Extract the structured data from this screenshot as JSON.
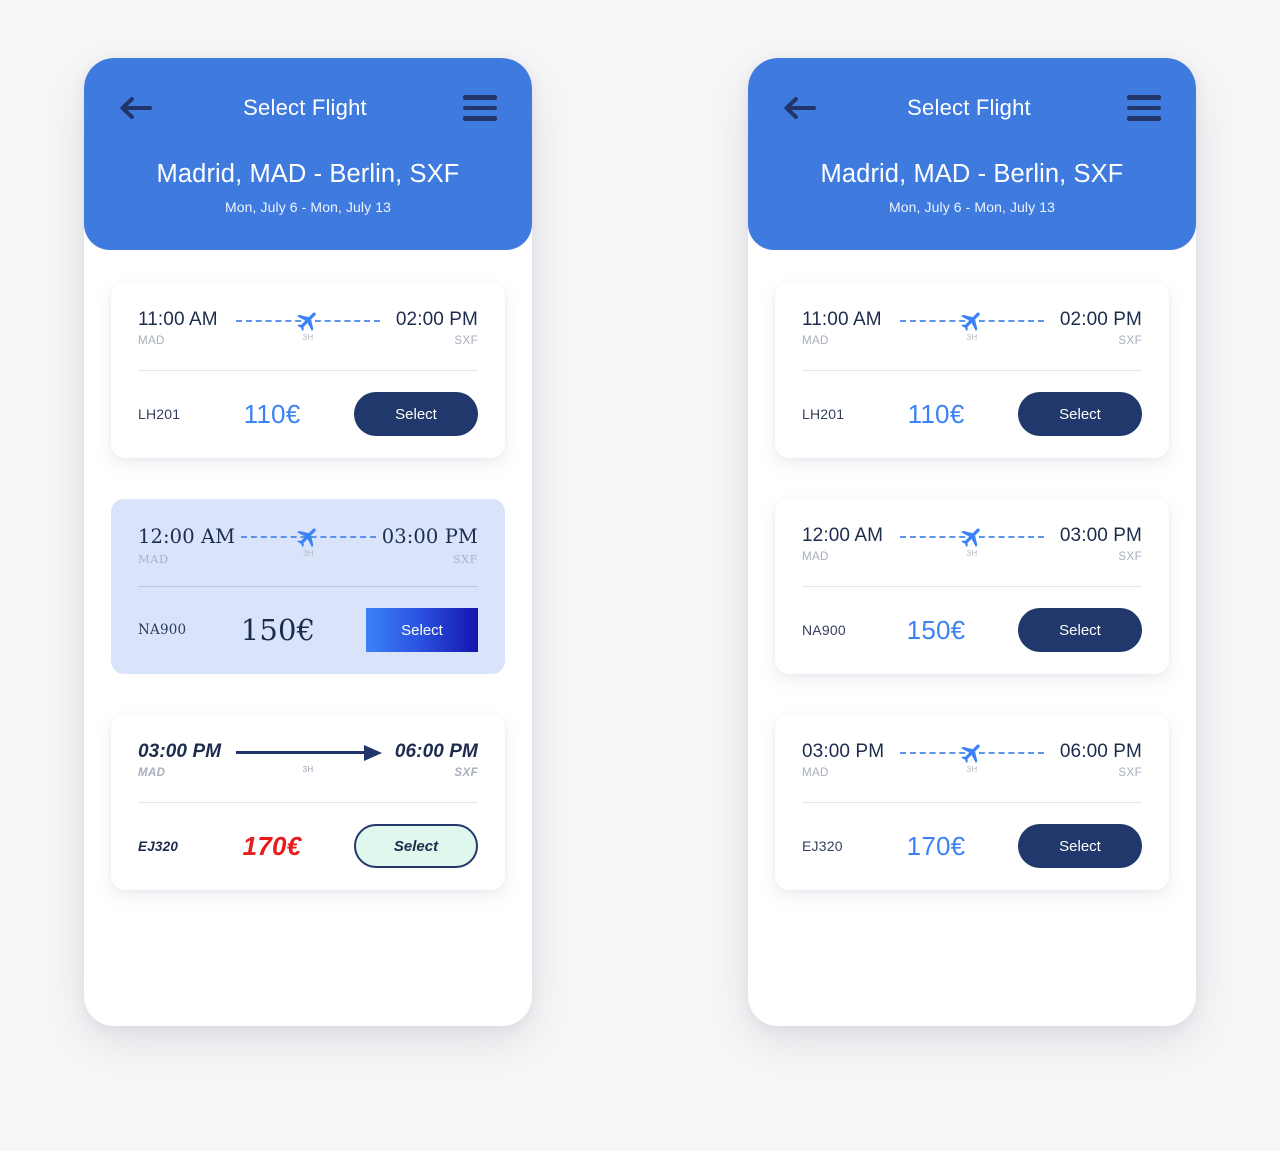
{
  "header": {
    "back_icon": "back-arrow-icon",
    "menu_icon": "hamburger-menu-icon",
    "title": "Select Flight",
    "route": "Madrid, MAD - Berlin, SXF",
    "dates": "Mon, July 6 - Mon, July 13"
  },
  "colors": {
    "header_blue": "#3f7bdf",
    "navy": "#20386b",
    "price_blue": "#3b82f6",
    "highlight_bg": "#d9e4fb",
    "mint": "#dff7ec",
    "red": "#e81c1c",
    "page_bg": "#f7f7f8"
  },
  "flights": [
    {
      "depart_time": "11:00 AM",
      "depart_airport": "MAD",
      "arrive_time": "02:00 PM",
      "arrive_airport": "SXF",
      "duration": "3H",
      "code": "LH201",
      "price": "110€",
      "select_label": "Select"
    },
    {
      "depart_time": "12:00 AM",
      "depart_airport": "MAD",
      "arrive_time": "03:00 PM",
      "arrive_airport": "SXF",
      "duration": "3H",
      "code": "NA900",
      "price": "150€",
      "select_label": "Select"
    },
    {
      "depart_time": "03:00 PM",
      "depart_airport": "MAD",
      "arrive_time": "06:00 PM",
      "arrive_airport": "SXF",
      "duration": "3H",
      "code": "EJ320",
      "price": "170€",
      "select_label": "Select"
    }
  ]
}
